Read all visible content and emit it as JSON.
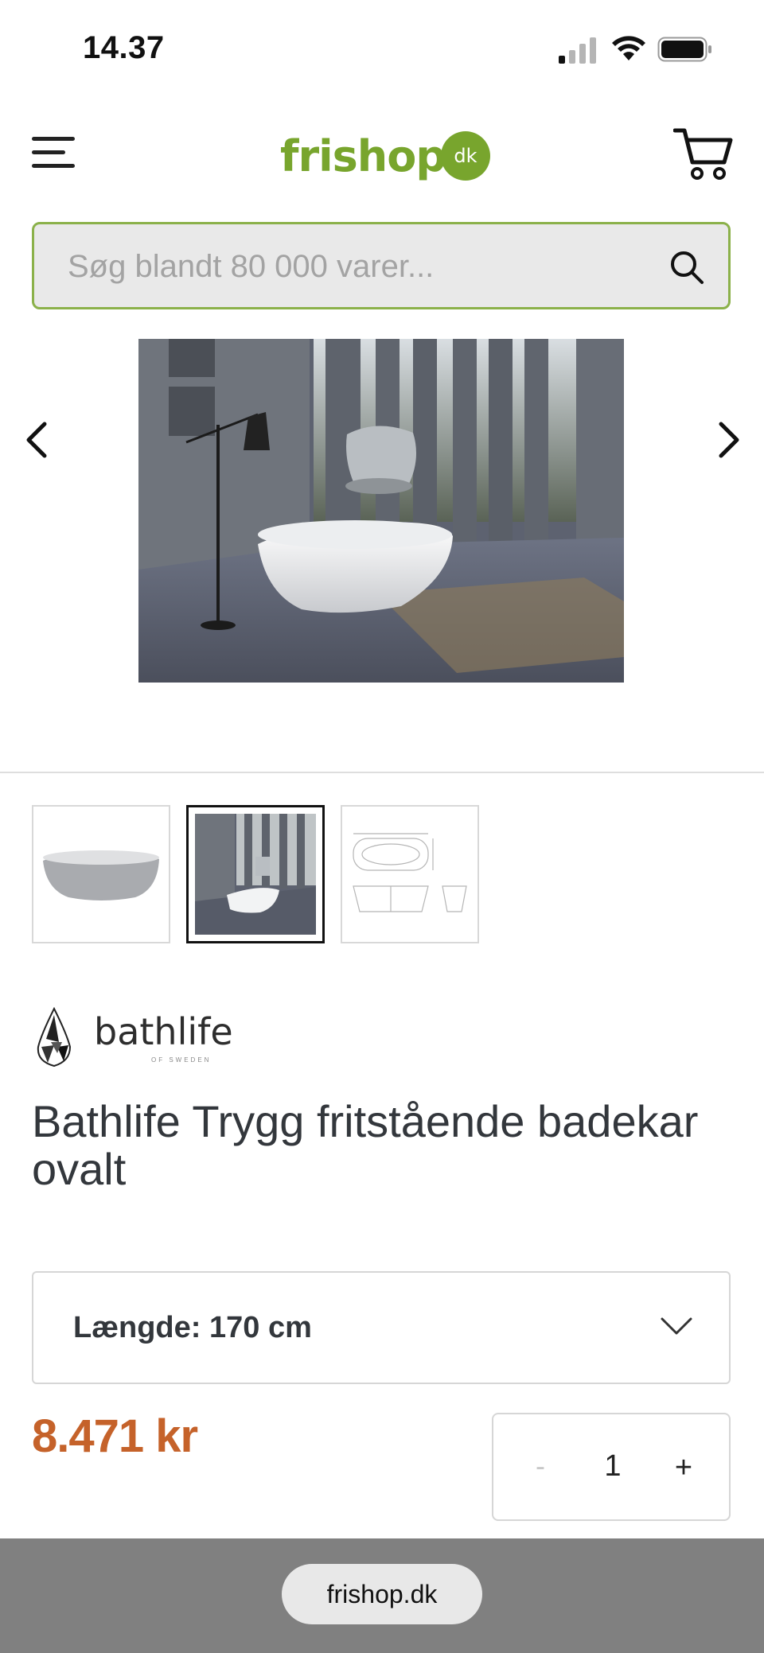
{
  "status_bar": {
    "time": "14.37"
  },
  "header": {
    "logo_main": "frishop",
    "logo_badge": "dk"
  },
  "search": {
    "placeholder": "Søg blandt 80 000 varer..."
  },
  "product": {
    "brand": "bathlife",
    "brand_subtitle": "OF SWEDEN",
    "title": "Bathlife Trygg fritstående badekar ovalt",
    "variant_label": "Længde: 170 cm",
    "price": "8.471 kr",
    "quantity": "1",
    "qty_minus": "-",
    "qty_plus": "+"
  },
  "browser": {
    "url": "frishop.dk"
  },
  "icons": {
    "menu": "hamburger-icon",
    "cart": "cart-icon",
    "search": "search-icon",
    "prev": "chevron-left-icon",
    "next": "chevron-right-icon",
    "variant": "chevron-down-icon"
  },
  "colors": {
    "brand_green": "#78a52d",
    "price_orange": "#c5622a"
  }
}
